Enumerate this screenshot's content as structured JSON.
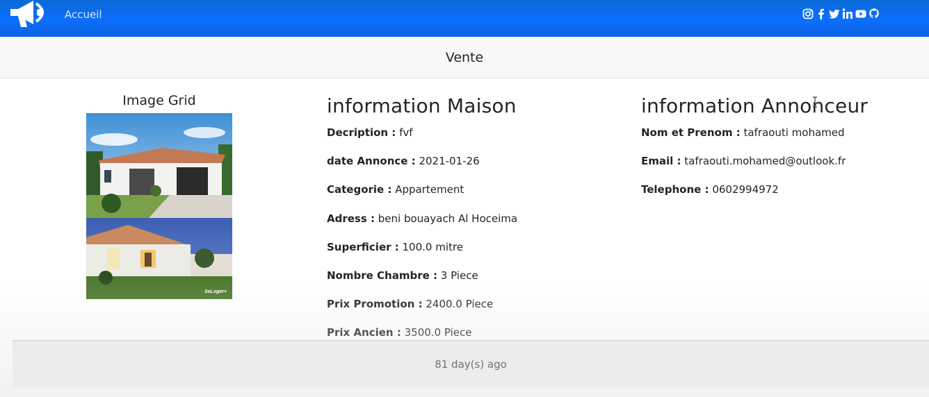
{
  "navbar": {
    "home_label": "Accueil",
    "brand_icon": "megaphone-icon",
    "social_icons": [
      "instagram-icon",
      "facebook-icon",
      "twitter-icon",
      "linkedin-icon",
      "youtube-icon",
      "github-icon"
    ]
  },
  "card": {
    "header": "Vente",
    "footer": "81 day(s) ago"
  },
  "images": {
    "title": "Image Grid",
    "watermark": "SeLoger+"
  },
  "maison": {
    "title": "information Maison",
    "fields": [
      {
        "label": "Decription :",
        "value": "fvf"
      },
      {
        "label": "date Annonce :",
        "value": "2021-01-26"
      },
      {
        "label": "Categorie :",
        "value": "Appartement"
      },
      {
        "label": "Adress :",
        "value": "beni bouayach Al Hoceima"
      },
      {
        "label": "Superficier :",
        "value": "100.0 mitre"
      },
      {
        "label": "Nombre Chambre :",
        "value": "3 Piece"
      },
      {
        "label": "Prix Promotion :",
        "value": "2400.0 Piece"
      },
      {
        "label": "Prix Ancien :",
        "value": "3500.0 Piece"
      }
    ]
  },
  "annonceur": {
    "title": "information Annonceur",
    "fields": [
      {
        "label": "Nom et Prenom :",
        "value": "tafraouti mohamed"
      },
      {
        "label": "Email :",
        "value": "tafraouti.mohamed@outlook.fr"
      },
      {
        "label": "Telephone :",
        "value": "0602994972"
      }
    ]
  },
  "colors": {
    "navbar": "#0d6efd",
    "header_bg": "#f7f7f7",
    "footer_bg": "#ececec"
  }
}
